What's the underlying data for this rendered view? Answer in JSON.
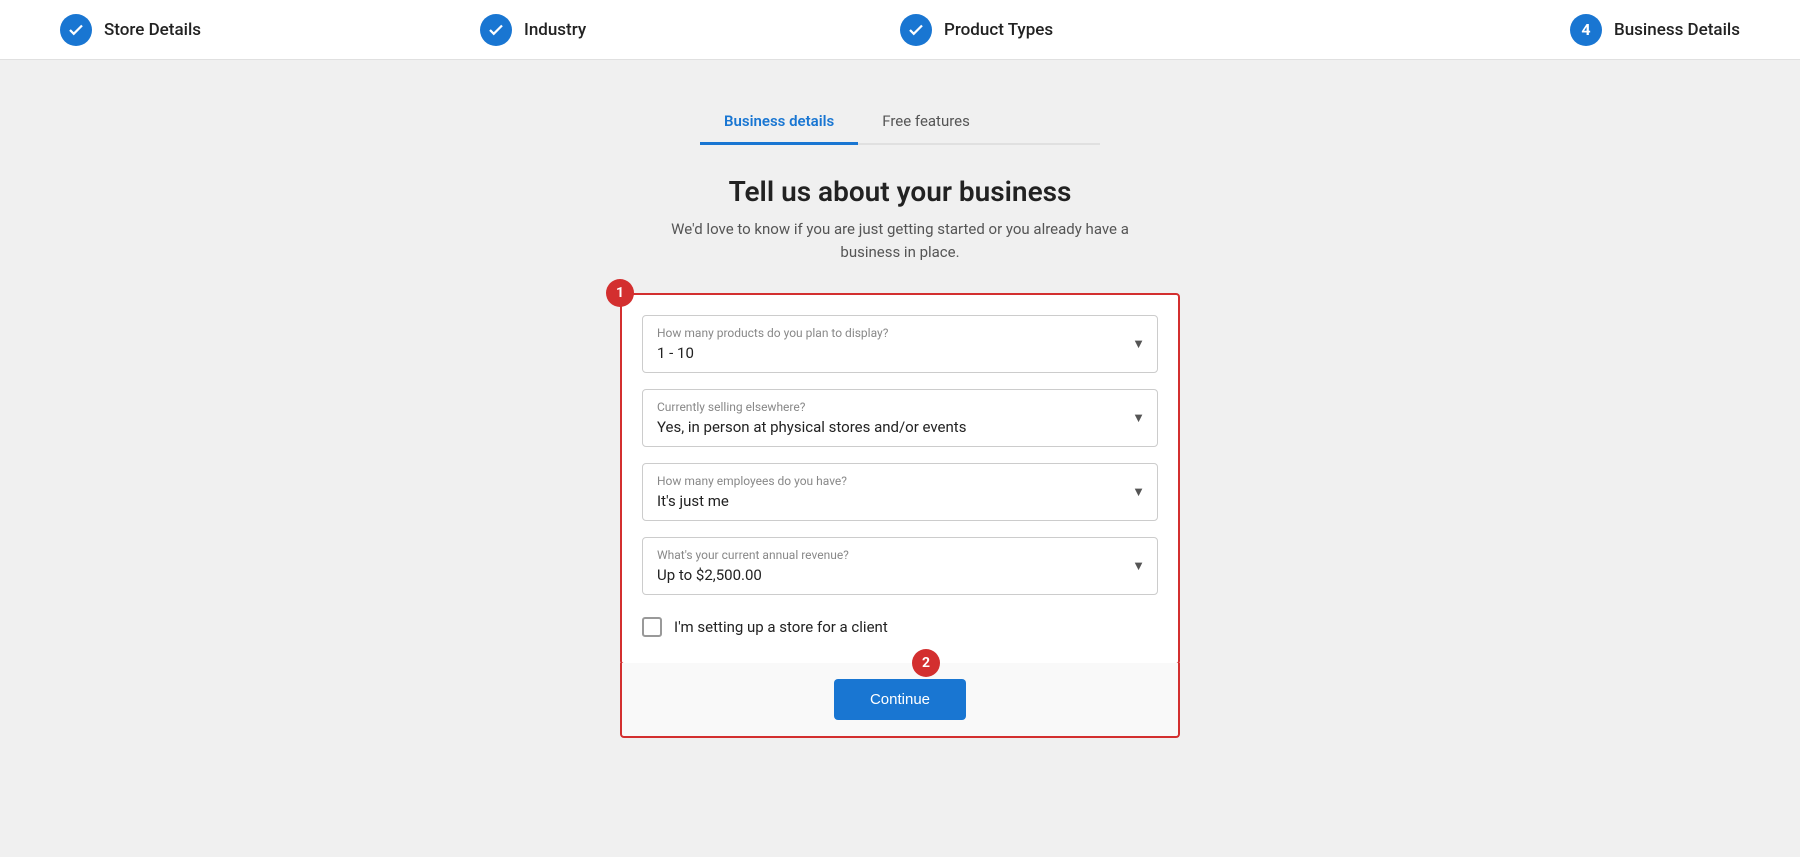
{
  "stepper": {
    "steps": [
      {
        "id": "store-details",
        "label": "Store Details",
        "state": "completed",
        "icon": "check"
      },
      {
        "id": "industry",
        "label": "Industry",
        "state": "completed",
        "icon": "check"
      },
      {
        "id": "product-types",
        "label": "Product Types",
        "state": "completed",
        "icon": "check"
      },
      {
        "id": "business-details",
        "label": "Business Details",
        "state": "active",
        "number": "4"
      }
    ]
  },
  "tabs": [
    {
      "id": "business-details",
      "label": "Business details",
      "active": true
    },
    {
      "id": "free-features",
      "label": "Free features",
      "active": false
    }
  ],
  "heading": {
    "title": "Tell us about your business",
    "subtitle": "We'd love to know if you are just getting started or you already have a business in place."
  },
  "form": {
    "fields": [
      {
        "id": "num-products",
        "label": "How many products do you plan to display?",
        "value": "1 - 10"
      },
      {
        "id": "selling-elsewhere",
        "label": "Currently selling elsewhere?",
        "value": "Yes, in person at physical stores and/or events"
      },
      {
        "id": "num-employees",
        "label": "How many employees do you have?",
        "value": "It's just me"
      },
      {
        "id": "annual-revenue",
        "label": "What's your current annual revenue?",
        "value": "Up to $2,500.00"
      }
    ],
    "checkbox": {
      "id": "client-store",
      "label": "I'm setting up a store for a client",
      "checked": false
    }
  },
  "annotations": {
    "badge1": "1",
    "badge2": "2"
  },
  "buttons": {
    "continue": "Continue"
  }
}
